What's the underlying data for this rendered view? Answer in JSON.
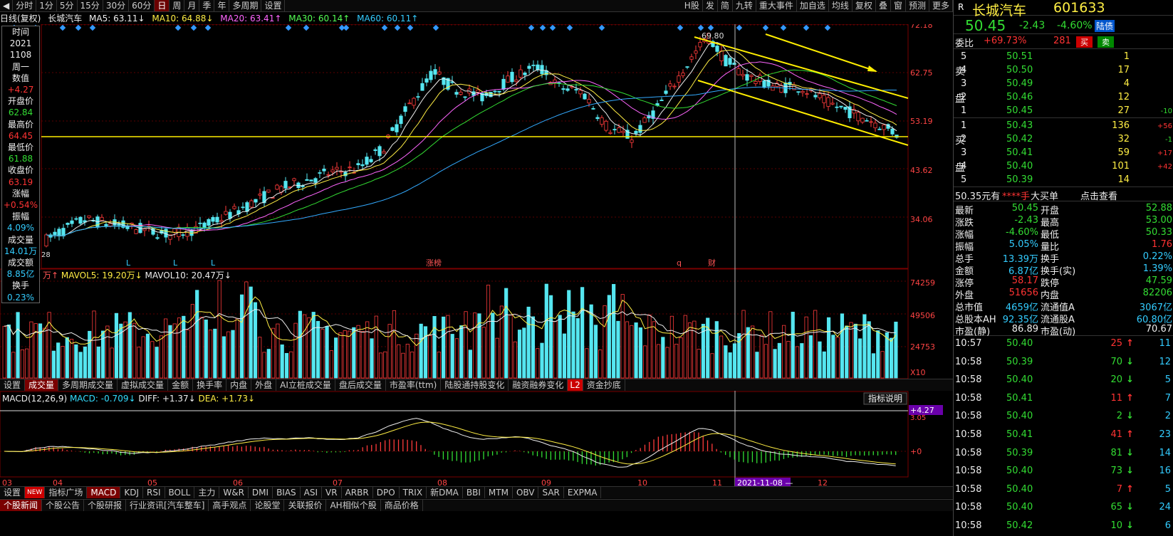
{
  "toolbar": {
    "left_items": [
      "分时",
      "1分",
      "5分",
      "15分",
      "30分",
      "60分",
      "日",
      "周",
      "月",
      "季",
      "年",
      "多周期",
      "设置"
    ],
    "active": "日",
    "right_items": [
      "H股",
      "发",
      "简",
      "九转",
      "重大事件",
      "加自选",
      "均线",
      "复权",
      "叠",
      "窗",
      "预测",
      "更多"
    ]
  },
  "ma_bar": {
    "chart_title": "日线(复权)",
    "stock": "长城汽车",
    "ma5": "MA5: 63.11↓",
    "ma10": "MA10: 64.88↓",
    "ma20": "MA20: 63.41↑",
    "ma30": "MA30: 60.14↑",
    "ma60": "MA60: 60.11↑"
  },
  "left_panel": [
    {
      "label": "时间",
      "value": "2021",
      "value2": "1108",
      "value3": "周一"
    },
    {
      "label": "数值",
      "value": "+4.27"
    },
    {
      "label": "开盘价",
      "value": "62.84"
    },
    {
      "label": "最高价",
      "value": "64.45"
    },
    {
      "label": "最低价",
      "value": "61.88"
    },
    {
      "label": "收盘价",
      "value": "63.19"
    },
    {
      "label": "涨幅",
      "value": "+0.54%"
    },
    {
      "label": "振幅",
      "value": "4.09%"
    },
    {
      "label": "成交量",
      "value": "14.01万"
    },
    {
      "label": "成交额",
      "value": "8.85亿"
    },
    {
      "label": "换手",
      "value": "0.23%"
    }
  ],
  "price_axis": [
    "72.18",
    "62.75",
    "53.19",
    "43.62",
    "34.06"
  ],
  "peak_label": "69.80",
  "low_label": "28",
  "event_marks": [
    "L",
    "L",
    "L",
    "涨榜",
    "q",
    "财"
  ],
  "vol_bar": {
    "unit": "万↑",
    "mavol5": "MAVOL5: 19.20万↓",
    "mavol10": "MAVOL10: 20.47万↓"
  },
  "vol_axis": [
    "74259",
    "49506",
    "24753",
    "X10"
  ],
  "indicator_tabs": [
    "设置",
    "成交量",
    "多周期成交量",
    "虚拟成交量",
    "金额",
    "换手率",
    "内盘",
    "外盘",
    "AI立桩成交量",
    "盘后成交量",
    "市盈率(ttm)",
    "陆股通持股变化",
    "融资融券变化",
    "L2",
    "资金抄底"
  ],
  "indicator_active": "成交量",
  "macd_bar": {
    "name": "MACD(12,26,9)",
    "macd": "MACD: -0.709↓",
    "diff": "DIFF: +1.37↓",
    "dea": "DEA: +1.73↓",
    "help": "指标说明"
  },
  "macd_axis": [
    "4.27",
    "3.05",
    "0"
  ],
  "x_axis": [
    "03",
    "04",
    "05",
    "06",
    "07",
    "08",
    "09",
    "10",
    "11",
    "12"
  ],
  "cursor_date": "2021-11-08",
  "indicators": [
    "设置",
    "NEW",
    "指标广场",
    "MACD",
    "KDJ",
    "RSI",
    "BOLL",
    "主力",
    "W&R",
    "DMI",
    "BIAS",
    "ASI",
    "VR",
    "ARBR",
    "DPO",
    "TRIX",
    "新DMA",
    "BBI",
    "MTM",
    "OBV",
    "SAR",
    "EXPMA"
  ],
  "indicator_sel": "MACD",
  "news_tabs": [
    "个股新闻",
    "个股公告",
    "个股研报",
    "行业资讯[汽车整车]",
    "高手观点",
    "论股堂",
    "关联报价",
    "AH相似个股",
    "商品价格"
  ],
  "news_active": "个股新闻",
  "quote": {
    "r_label": "R",
    "name": "长城汽车",
    "code": "601633",
    "price": "50.45",
    "change": "-2.43",
    "pct": "-4.60%",
    "tag": "陆债",
    "webi_label": "委比",
    "webi": "+69.73%",
    "webi_num": "281",
    "buy": "买",
    "sell": "卖",
    "asks": [
      {
        "n": "5",
        "p": "50.51",
        "v": "1",
        "c": ""
      },
      {
        "n": "4",
        "p": "50.50",
        "v": "17",
        "c": ""
      },
      {
        "n": "3",
        "p": "50.49",
        "v": "4",
        "c": ""
      },
      {
        "n": "2",
        "p": "50.46",
        "v": "12",
        "c": ""
      },
      {
        "n": "1",
        "p": "50.45",
        "v": "27",
        "c": "-10"
      }
    ],
    "bids": [
      {
        "n": "1",
        "p": "50.43",
        "v": "136",
        "c": "+56"
      },
      {
        "n": "2",
        "p": "50.42",
        "v": "32",
        "c": "-1"
      },
      {
        "n": "3",
        "p": "50.41",
        "v": "59",
        "c": "+17"
      },
      {
        "n": "4",
        "p": "50.40",
        "v": "101",
        "c": "+42"
      },
      {
        "n": "5",
        "p": "50.39",
        "v": "14",
        "c": ""
      }
    ],
    "ask_label": [
      "卖",
      "盘"
    ],
    "bid_label": [
      "买",
      "盘"
    ],
    "bigorder": {
      "left": "50.35元有",
      "mid": "****手",
      "mid2": "大买单",
      "right": "点击查看"
    },
    "stats": [
      [
        "最新",
        "50.45",
        "开盘",
        "52.88"
      ],
      [
        "涨跌",
        "-2.43",
        "最高",
        "53.00"
      ],
      [
        "涨幅",
        "-4.60%",
        "最低",
        "50.33"
      ],
      [
        "振幅",
        "5.05%",
        "量比",
        "1.76"
      ],
      [
        "总手",
        "13.39万",
        "换手",
        "0.22%"
      ],
      [
        "金额",
        "6.87亿",
        "换手(实)",
        "1.39%"
      ],
      [
        "涨停",
        "58.17",
        "跌停",
        "47.59"
      ],
      [
        "外盘",
        "51656",
        "内盘",
        "82206"
      ],
      [
        "总市值",
        "4659亿",
        "流通值A",
        "3067亿"
      ],
      [
        "总股本AH",
        "92.35亿",
        "流通股A",
        "60.80亿"
      ],
      [
        "市盈(静)",
        "86.89",
        "市盈(动)",
        "70.67"
      ]
    ],
    "ticks": [
      [
        "10:57",
        "50.40",
        "25",
        "↑",
        "11"
      ],
      [
        "10:58",
        "50.39",
        "70",
        "↓",
        "12"
      ],
      [
        "10:58",
        "50.40",
        "20",
        "↓",
        "5"
      ],
      [
        "10:58",
        "50.41",
        "11",
        "↑",
        "7"
      ],
      [
        "10:58",
        "50.40",
        "2",
        "↓",
        "2"
      ],
      [
        "10:58",
        "50.41",
        "41",
        "↑",
        "23"
      ],
      [
        "10:58",
        "50.39",
        "81",
        "↓",
        "14"
      ],
      [
        "10:58",
        "50.40",
        "73",
        "↓",
        "16"
      ],
      [
        "10:58",
        "50.40",
        "7",
        "↑",
        "5"
      ],
      [
        "10:58",
        "50.40",
        "65",
        "↓",
        "24"
      ],
      [
        "10:58",
        "50.42",
        "10",
        "↓",
        "6"
      ]
    ]
  }
}
